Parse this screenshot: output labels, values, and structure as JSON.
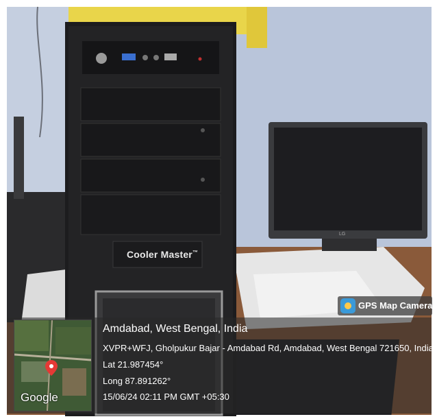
{
  "brand_label": "Cooler Master",
  "brand_tm": "™",
  "badge": {
    "label": "GPS Map Camera",
    "icon": "gps-map-camera-icon"
  },
  "map": {
    "attribution": "Google"
  },
  "location": {
    "title": "Amdabad, West Bengal, India",
    "address": "XVPR+WFJ, Gholpukur Bajar - Amdabad Rd, Amdabad, West Bengal 721650, India",
    "lat": "Lat 21.987454°",
    "long": "Long 87.891262°",
    "datetime": "15/06/24 02:11 PM GMT +05:30"
  },
  "colors": {
    "wall": "#b9c7dd",
    "cabinet": "#1c1c1e",
    "caption_bg": "#2c2c2c",
    "pin": "#e53935"
  }
}
